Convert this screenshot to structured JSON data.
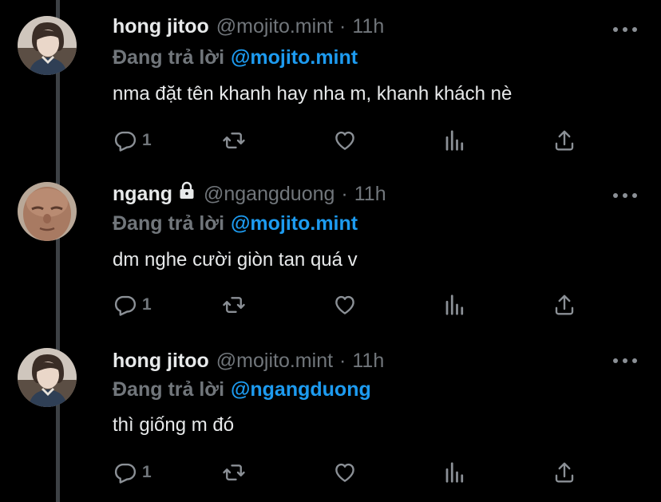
{
  "tweets": [
    {
      "name": "hong jitoo",
      "handle": "@mojito.mint",
      "dot": "·",
      "time": "11h",
      "reply_prefix": "Đang trả lời",
      "reply_to": "@mojito.mint",
      "text": "nma đặt tên khanh hay nha m, khanh khách nè",
      "reply_count": "1",
      "locked": false
    },
    {
      "name": "ngang",
      "handle": "@ngangduong",
      "dot": "·",
      "time": "11h",
      "reply_prefix": "Đang trả lời",
      "reply_to": "@mojito.mint",
      "text": "dm nghe cười giòn tan quá v",
      "reply_count": "1",
      "locked": true
    },
    {
      "name": "hong jitoo",
      "handle": "@mojito.mint",
      "dot": "·",
      "time": "11h",
      "reply_prefix": "Đang trả lời",
      "reply_to": "@ngangduong",
      "text": "thì giống m đó",
      "reply_count": "1",
      "locked": false
    }
  ],
  "colors": {
    "background": "#000000",
    "accent": "#1d9bf0",
    "muted": "#71767b",
    "text": "#e7e9ea"
  },
  "icons": [
    "reply-icon",
    "retweet-icon",
    "like-icon",
    "analytics-icon",
    "share-icon",
    "more-icon",
    "lock-icon"
  ]
}
